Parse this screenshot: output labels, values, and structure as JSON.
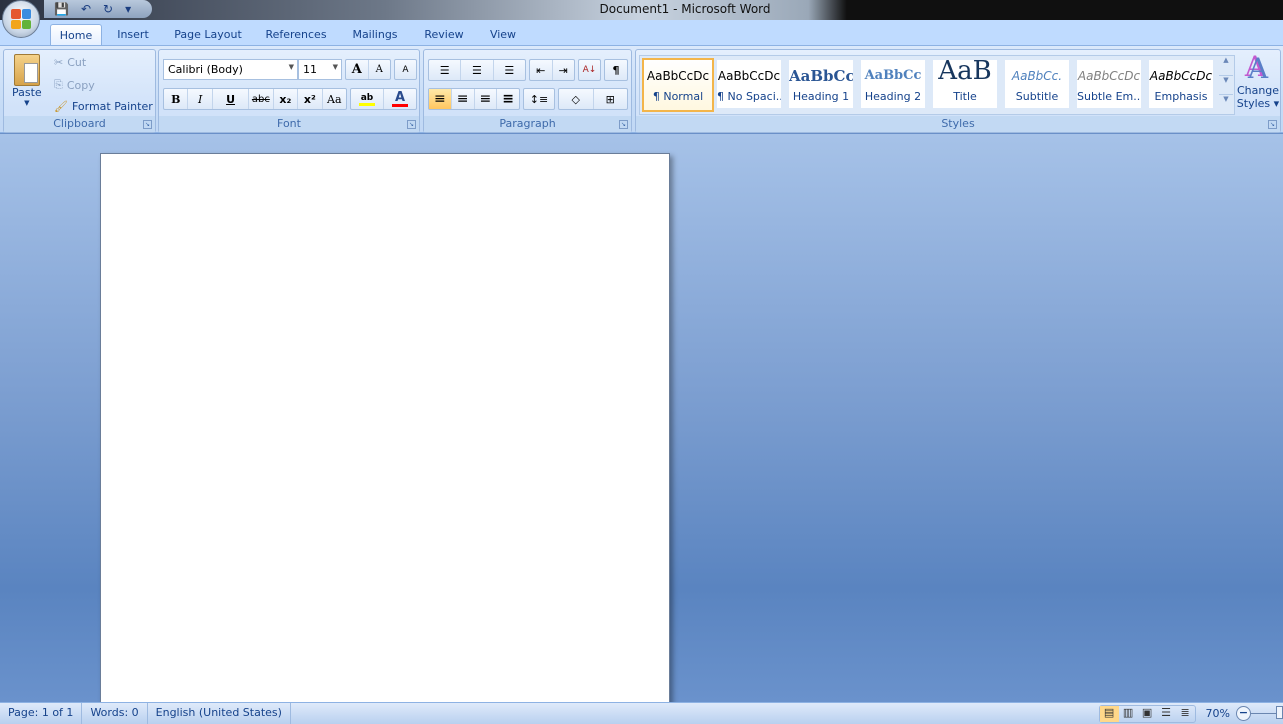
{
  "title": "Document1 - Microsoft Word",
  "qat": {
    "save_icon": "💾",
    "undo_icon": "↶",
    "redo_icon": "↻",
    "customize_icon": "▾"
  },
  "tabs": [
    "Home",
    "Insert",
    "Page Layout",
    "References",
    "Mailings",
    "Review",
    "View"
  ],
  "clipboard": {
    "label": "Clipboard",
    "paste": "Paste",
    "cut": "Cut",
    "copy": "Copy",
    "format_painter": "Format Painter"
  },
  "font": {
    "label": "Font",
    "name": "Calibri (Body)",
    "size": "11",
    "grow": "A",
    "shrink": "A",
    "clear": "A",
    "bold": "B",
    "italic": "I",
    "underline": "U",
    "strike": "abc",
    "subscript": "x₂",
    "superscript": "x²",
    "case": "Aa",
    "highlight": "ab",
    "color": "A",
    "highlight_color": "#ffff00",
    "font_color": "#ff0000"
  },
  "paragraph": {
    "label": "Paragraph",
    "bullets": "☰",
    "numbering": "☰",
    "multilevel": "☰",
    "dec_indent": "⇤",
    "inc_indent": "⇥",
    "sort": "A↓",
    "show": "¶",
    "align_left": "≡",
    "center": "≡",
    "align_right": "≡",
    "justify": "≡",
    "spacing": "↕≡",
    "shading": "◇",
    "borders": "⊞"
  },
  "styles": {
    "label": "Styles",
    "items": [
      {
        "sample": "AaBbCcDc",
        "name": "¶ Normal"
      },
      {
        "sample": "AaBbCcDc",
        "name": "¶ No Spaci..."
      },
      {
        "sample": "AaBbCc",
        "name": "Heading 1"
      },
      {
        "sample": "AaBbCc",
        "name": "Heading 2"
      },
      {
        "sample": "AaB",
        "name": "Title"
      },
      {
        "sample": "AaBbCc.",
        "name": "Subtitle"
      },
      {
        "sample": "AaBbCcDc",
        "name": "Subtle Em..."
      },
      {
        "sample": "AaBbCcDc",
        "name": "Emphasis"
      }
    ],
    "change_icon": "A",
    "change_line1": "Change",
    "change_line2": "Styles ▾"
  },
  "status": {
    "page": "Page: 1 of 1",
    "words": "Words: 0",
    "language": "English (United States)",
    "zoom": "70%",
    "zoom_out": "−"
  }
}
